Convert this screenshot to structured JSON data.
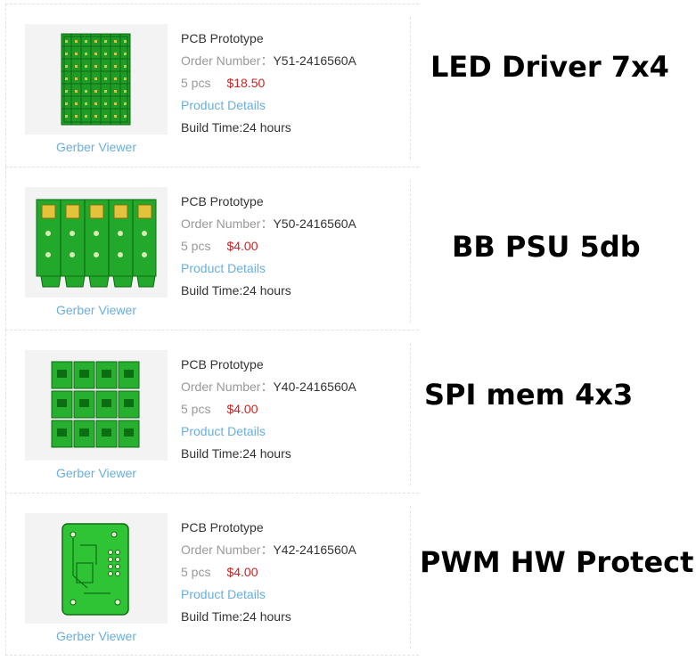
{
  "orders": [
    {
      "product_type": "PCB Prototype",
      "order_label": "Order Number：",
      "order_number": "Y51-2416560A",
      "quantity": "5 pcs",
      "price": "$18.50",
      "details_label": "Product Details",
      "build_time": "Build Time:24 hours",
      "gerber_label": "Gerber Viewer",
      "thumbnail": "led-driver-panel"
    },
    {
      "product_type": "PCB Prototype",
      "order_label": "Order Number：",
      "order_number": "Y50-2416560A",
      "quantity": "5 pcs",
      "price": "$4.00",
      "details_label": "Product Details",
      "build_time": "Build Time:24 hours",
      "gerber_label": "Gerber Viewer",
      "thumbnail": "psu-panel"
    },
    {
      "product_type": "PCB Prototype",
      "order_label": "Order Number：",
      "order_number": "Y40-2416560A",
      "quantity": "5 pcs",
      "price": "$4.00",
      "details_label": "Product Details",
      "build_time": "Build Time:24 hours",
      "gerber_label": "Gerber Viewer",
      "thumbnail": "spi-mem-panel"
    },
    {
      "product_type": "PCB Prototype",
      "order_label": "Order Number：",
      "order_number": "Y42-2416560A",
      "quantity": "5 pcs",
      "price": "$4.00",
      "details_label": "Product Details",
      "build_time": "Build Time:24 hours",
      "gerber_label": "Gerber Viewer",
      "thumbnail": "pwm-protect-board"
    }
  ],
  "annotations": [
    "LED Driver 7x4",
    "BB PSU 5db",
    "SPI mem 4x3",
    "PWM HW Protect"
  ],
  "colors": {
    "pcb_green": "#22a82a",
    "pcb_dark": "#0d6d12",
    "link": "#6aaedc",
    "price": "#cc2222"
  }
}
